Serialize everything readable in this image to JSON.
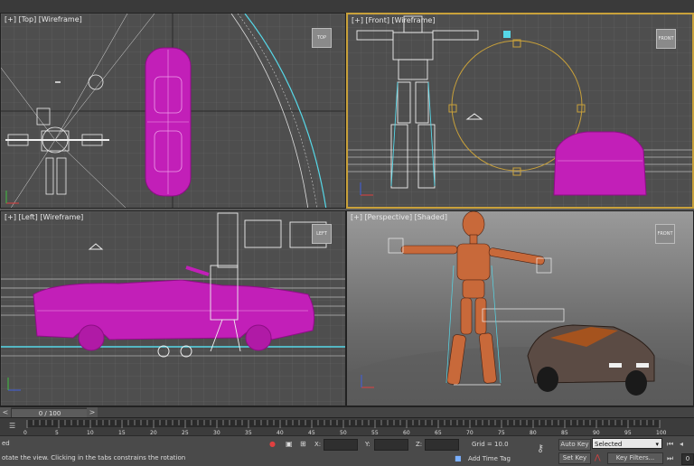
{
  "viewports": {
    "top": {
      "label": "[+] [Top] [Wireframe]",
      "cube": "TOP"
    },
    "front": {
      "label": "[+] [Front] [Wireframe]",
      "cube": "FRONT"
    },
    "left": {
      "label": "[+] [Left] [Wireframe]",
      "cube": "LEFT"
    },
    "perspective": {
      "label": "[+] [Perspective] [Shaded]",
      "cube": "FRONT"
    }
  },
  "timeline": {
    "slider_text": "0 / 100",
    "prev": "<",
    "next": ">",
    "ticks": [
      "0",
      "5",
      "10",
      "15",
      "20",
      "25",
      "30",
      "35",
      "40",
      "45",
      "50",
      "55",
      "60",
      "65",
      "70",
      "75",
      "80",
      "85",
      "90",
      "95",
      "100"
    ]
  },
  "status": {
    "line1": "ed",
    "line2": "otate the view.  Clicking in the tabs constrains the rotation",
    "x_label": "X:",
    "y_label": "Y:",
    "z_label": "Z:",
    "grid": "Grid = 10.0",
    "add_time_tag": "Add Time Tag",
    "auto_key": "Auto Key",
    "set_key": "Set Key",
    "selected": "Selected",
    "key_filters": "Key Filters...",
    "frame_value": "0"
  },
  "colors": {
    "magenta": "#c21fb8",
    "wire": "#e8e8e8",
    "cyan": "#56d8e8",
    "grid": "#6a6a6a",
    "orange": "#c8693a",
    "active_border": "#c9a13a"
  }
}
